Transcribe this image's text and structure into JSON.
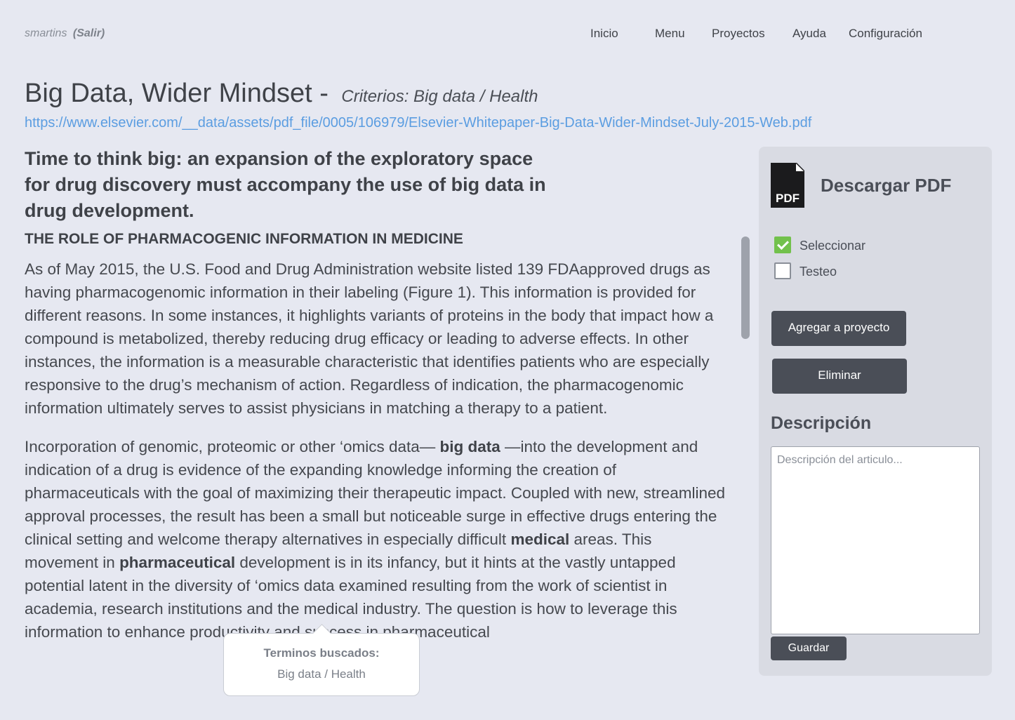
{
  "user": {
    "name": "smartins",
    "logout_label": "(Salir)"
  },
  "nav": {
    "items": [
      "Inicio",
      "Menu",
      "Proyectos",
      "Ayuda",
      "Configuración"
    ]
  },
  "document": {
    "title": "Big Data, Wider Mindset -",
    "criteria": "Criterios: Big data / Health",
    "url": "https://www.elsevier.com/__data/assets/pdf_file/0005/106979/Elsevier-Whitepaper-Big-Data-Wider-Mindset-July-2015-Web.pdf",
    "headline": "Time to think big: an expansion of the exploratory space for drug discovery must accompany the use of big data in drug development.",
    "section_heading": "THE ROLE OF PHARMACOGENIC INFORMATION IN MEDICINE",
    "paragraph1": "As of May 2015, the U.S. Food and Drug Administration website listed 139 FDAapproved drugs as having pharmacogenomic information in their labeling (Figure 1). This information is provided for different reasons. In some instances, it highlights variants of proteins in the body that impact how a compound is metabolized, thereby reducing drug efficacy or leading to adverse effects. In other instances, the information is a measurable characteristic that identifies patients who are especially responsive to the drug’s mechanism of action. Regardless of indication, the pharmacogenomic information ultimately serves to assist physicians in matching a therapy to a patient.",
    "paragraph2": {
      "part1": "Incorporation of genomic, proteomic or other ‘omics data— ",
      "term1": "big data",
      "part2": " —into the development and indication of a drug is evidence of the expanding knowledge informing the creation of pharmaceuticals with the goal of maximizing their therapeutic impact. Coupled with new, streamlined approval processes, the result has been a small but noticeable surge in effective drugs entering the clinical setting and welcome therapy alternatives in especially difficult ",
      "term2": "medical",
      "part3": " areas. This movement in ",
      "term3": "pharmaceutical",
      "part4": " development is in its infancy, but it hints at the vastly untapped potential latent in the diversity of ‘omics data examined resulting from the work of scientist in academia, research institutions and the medical industry. The question is how to leverage this information to enhance productivity and success in pharmaceutical"
    }
  },
  "tooltip": {
    "title": "Terminos buscados:",
    "value": "Big data / Health"
  },
  "sidebar": {
    "pdf_icon_text": "PDF",
    "download_label": "Descargar PDF",
    "checkbox_select": {
      "label": "Seleccionar",
      "checked": true
    },
    "checkbox_test": {
      "label": "Testeo",
      "checked": false
    },
    "add_project_label": "Agregar a proyecto",
    "delete_label": "Eliminar",
    "description_title": "Descripción",
    "description_placeholder": "Descripción del articulo...",
    "save_label": "Guardar"
  },
  "colors": {
    "link": "#5b9de1",
    "accent_check": "#72c14c",
    "button": "#4a4e57"
  }
}
